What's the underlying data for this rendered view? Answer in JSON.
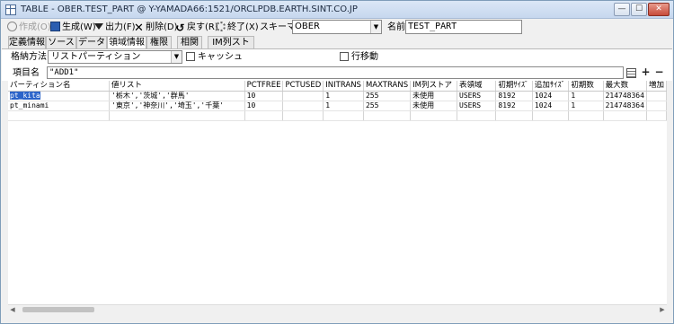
{
  "window": {
    "title": "TABLE - OBER.TEST_PART @ Y-YAMADA66:1521/ORCLPDB.EARTH.SINT.CO.JP",
    "min_glyph": "—",
    "max_glyph": "☐",
    "close_glyph": "✕"
  },
  "toolbar": {
    "create": "作成(O)",
    "generate": "生成(W)",
    "output": "出力(F)",
    "delete": "削除(D)",
    "back": "戻す(R)",
    "exit": "終了(X)",
    "schema_label": "スキーマ",
    "schema_value": "OBER",
    "name_label": "名前",
    "name_value": "TEST_PART"
  },
  "tabs": [
    {
      "label": "定義情報"
    },
    {
      "label": "ソース"
    },
    {
      "label": "データ"
    },
    {
      "label": "領域情報"
    },
    {
      "label": "権限"
    },
    {
      "label": "相関"
    },
    {
      "label": "IM列ストア"
    }
  ],
  "storage": {
    "label": "格納方法",
    "value": "リストパーティション",
    "cache_label": "キャッシュ",
    "row_move_label": "行移動"
  },
  "item": {
    "label": "項目名",
    "value": "\"ADD1\""
  },
  "grid": {
    "columns": [
      "パーティション名",
      "値リスト",
      "PCTFREE",
      "PCTUSED",
      "INITRANS",
      "MAXTRANS",
      "IM列ストア",
      "表領域",
      "初期ｻｲｽﾞ",
      "追加ｻｲｽﾞ",
      "初期数",
      "最大数",
      "増加"
    ],
    "rows": [
      [
        "pt_kita",
        "'栃木','茨城','群馬'",
        "10",
        "",
        "1",
        "255",
        "未使用",
        "USERS",
        "8192",
        "1024",
        "1",
        "214748364",
        ""
      ],
      [
        "pt_minami",
        "'東京','神奈川','埼玉','千葉'",
        "10",
        "",
        "1",
        "255",
        "未使用",
        "USERS",
        "8192",
        "1024",
        "1",
        "214748364",
        ""
      ]
    ]
  }
}
